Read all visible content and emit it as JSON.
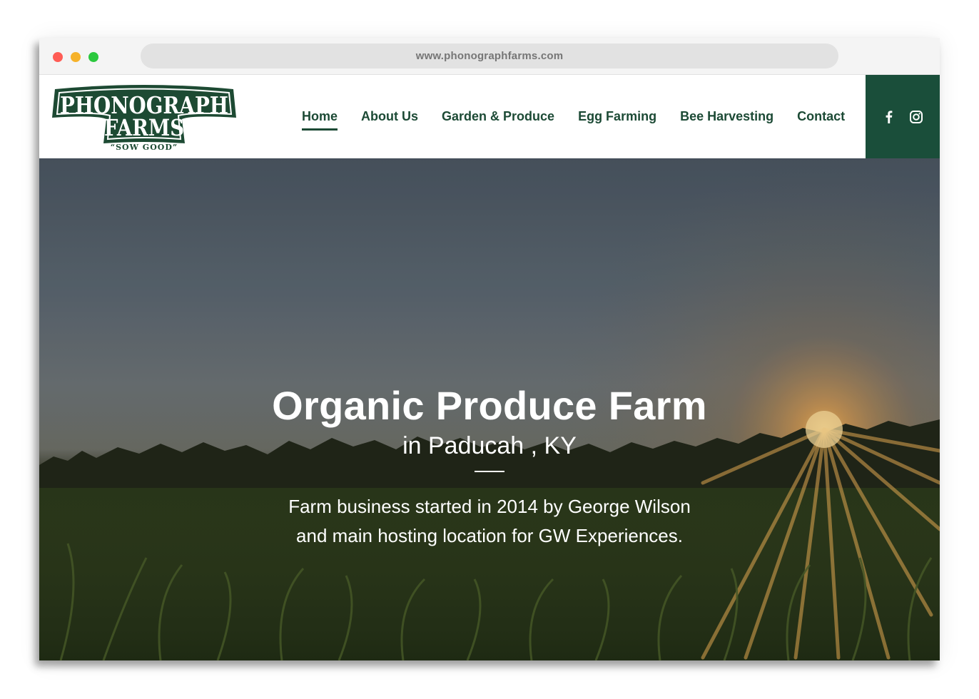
{
  "browser": {
    "url": "www.phonographfarms.com"
  },
  "logo": {
    "line1": "PHONOGRAPH",
    "line2": "FARMS",
    "tagline": "“SOW GOOD”"
  },
  "nav": {
    "items": [
      {
        "label": "Home",
        "active": true
      },
      {
        "label": "About Us"
      },
      {
        "label": "Garden & Produce"
      },
      {
        "label": "Egg Farming"
      },
      {
        "label": "Bee Harvesting"
      },
      {
        "label": "Contact"
      }
    ]
  },
  "social": {
    "icons": [
      "facebook-icon",
      "instagram-icon"
    ]
  },
  "hero": {
    "title": "Organic Produce Farm",
    "subtitle": "in Paducah , KY",
    "text_line1": "Farm business started in 2014 by George Wilson",
    "text_line2": "and main hosting location for GW Experiences."
  },
  "colors": {
    "brand_green": "#1a4e3a",
    "nav_text": "#1c4a35",
    "hero_text": "#ffffff"
  }
}
